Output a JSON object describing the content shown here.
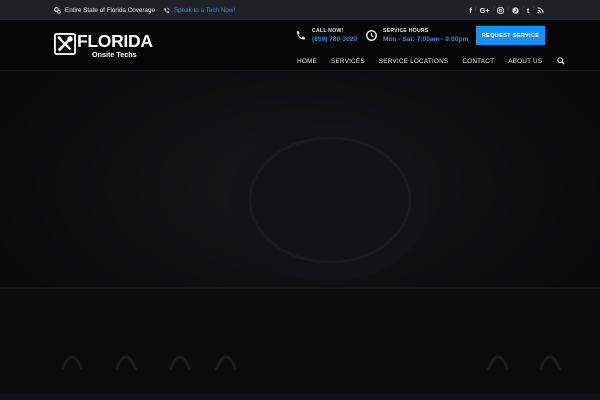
{
  "topbar": {
    "coverage_text": "Entire State of Florida Coverage",
    "speak_link": "Speak to a Tech Now!",
    "social": [
      "facebook-icon",
      "google-plus-icon",
      "instagram-icon",
      "pinterest-icon",
      "tumblr-icon",
      "rss-icon"
    ]
  },
  "header": {
    "logo_title": "FLORIDA",
    "logo_subtitle": "Onsite Techs",
    "call_label": "CALL NOW!",
    "call_number": "(859) 780-3020",
    "hours_label": "SERVICE HOURS",
    "hours_value": "Mon - Sat: 7:00am - 9:00pm",
    "request_button": "REQUEST SERVICE"
  },
  "nav": {
    "items": [
      "HOME",
      "SERVICES",
      "SERVICE LOCATIONS",
      "CONTACT",
      "ABOUT US"
    ]
  },
  "colors": {
    "accent": "#1e8ff0",
    "link": "#2f8cdf",
    "topbar_bg": "#1e2126",
    "header_bg": "#050505"
  }
}
